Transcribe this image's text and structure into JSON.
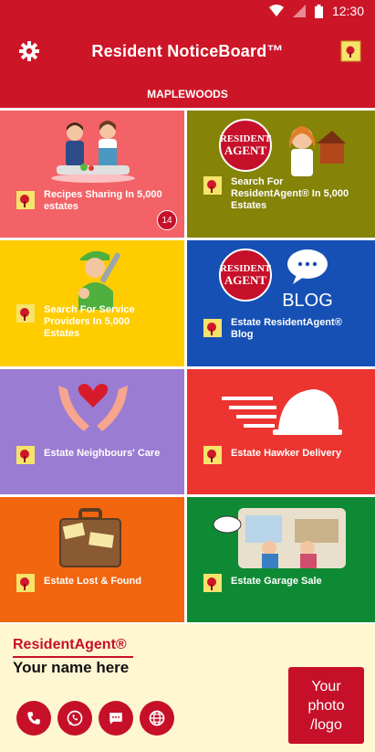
{
  "status_bar": {
    "time": "12:30"
  },
  "app_bar": {
    "title": "Resident NoticeBoard™"
  },
  "sub_bar": {
    "estate": "MAPLEWOODS"
  },
  "tiles": [
    {
      "label": "Recipes Sharing In 5,000 estates",
      "color": "#f26266",
      "badge": "14",
      "icon": "cooking-couple-icon"
    },
    {
      "label": "Search For ResidentAgent® In 5,000 Estates",
      "color": "#858308",
      "icon": "resident-agent-icon"
    },
    {
      "label": "Search For Service Providers In 5,000 Estates",
      "color": "#ffcc00",
      "icon": "handyman-icon"
    },
    {
      "label": "Estate ResidentAgent® Blog",
      "color": "#1650b4",
      "blog_word": "BLOG",
      "icon": "blog-icon"
    },
    {
      "label": "Estate Neighbours' Care",
      "color": "#9b7cd3",
      "icon": "care-hands-icon"
    },
    {
      "label": "Estate Hawker Delivery",
      "color": "#ec3530",
      "icon": "delivery-cloche-icon"
    },
    {
      "label": "Estate Lost & Found",
      "color": "#f2660f",
      "icon": "suitcase-icon"
    },
    {
      "label": "Estate Garage Sale",
      "color": "#0f8a34",
      "icon": "garage-sale-icon"
    }
  ],
  "card": {
    "brand": "ResidentAgent®",
    "name": "Your name here",
    "photo_placeholder": "Your photo /logo",
    "actions": [
      "phone-icon",
      "whatsapp-icon",
      "chat-icon",
      "globe-icon"
    ]
  }
}
